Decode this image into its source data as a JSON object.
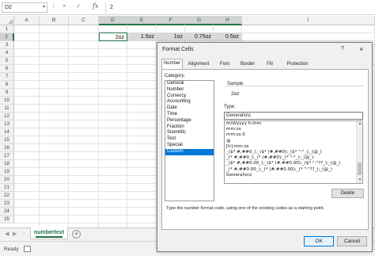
{
  "formula_bar": {
    "name_box": "D2",
    "cancel_icon": "×",
    "enter_icon": "✓",
    "fx_label": "fx",
    "value": "2"
  },
  "grid": {
    "columns": [
      "A",
      "B",
      "C",
      "D",
      "E",
      "F",
      "G",
      "H",
      "I"
    ],
    "selected_columns": [
      "D",
      "E",
      "F",
      "G",
      "H"
    ],
    "rows": [
      "1",
      "2",
      "3",
      "4",
      "5",
      "6",
      "7",
      "8",
      "9",
      "10",
      "11",
      "12",
      "13",
      "14",
      "15",
      "16",
      "17",
      "18",
      "19",
      "20",
      "21",
      "22",
      "23",
      "24",
      "25"
    ],
    "selected_row": "2",
    "row2_cells": [
      {
        "col": "D",
        "value": "2oz"
      },
      {
        "col": "E",
        "value": "1.5oz"
      },
      {
        "col": "F",
        "value": "1oz"
      },
      {
        "col": "G",
        "value": "0.75oz"
      },
      {
        "col": "H",
        "value": "0.5oz"
      }
    ]
  },
  "sheet_tabs": {
    "active_tab": "numbertext",
    "add_sheet": "+"
  },
  "status_bar": {
    "status": "Ready"
  },
  "dialog": {
    "title": "Format Cells",
    "help": "?",
    "close": "×",
    "tabs": [
      "Number",
      "Alignment",
      "Font",
      "Border",
      "Fill",
      "Protection"
    ],
    "active_tab": "Number",
    "category_label": "Category:",
    "categories": [
      "General",
      "Number",
      "Currency",
      "Accounting",
      "Date",
      "Time",
      "Percentage",
      "Fraction",
      "Scientific",
      "Text",
      "Special",
      "Custom"
    ],
    "selected_category": "Custom",
    "sample_label": "Sample",
    "sample_value": "2oz",
    "type_label": "Type:",
    "type_value": "General\\o\\z",
    "format_codes": [
      "m/d/yyyy h:mm",
      "mm:ss",
      "mm:ss.0",
      "@",
      "[h]:mm:ss",
      "_($* #,##0_);_($* (#,##0);_($* \"-\"_);_(@_)",
      "_(* #,##0_);_(* (#,##0);_(* \"-\"_);_(@_)",
      "_($* #,##0.00_);_($* (#,##0.00);_($* \"-\"??_);_(@_)",
      "_(* #,##0.00_);_(* (#,##0.00);_(* \"-\"??_);_(@_)",
      "General\\o\\z"
    ],
    "delete_label": "Delete",
    "description": "Type the number format code, using one of the existing codes as a starting point.",
    "ok_label": "OK",
    "cancel_label": "Cancel"
  },
  "colors": {
    "excel_green": "#217346",
    "selection_blue": "#0078d7",
    "selection_gray": "#d9d9d9"
  }
}
